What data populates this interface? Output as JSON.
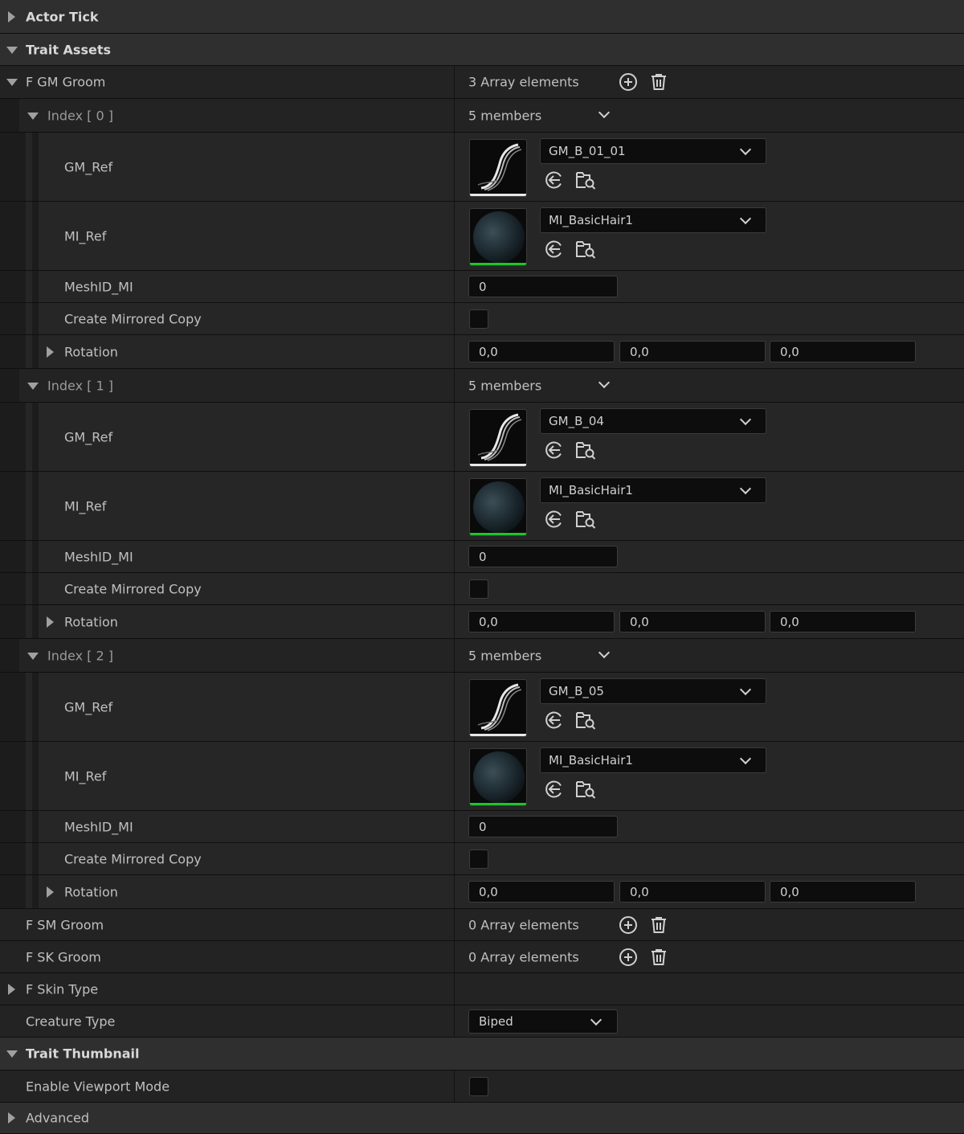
{
  "categories": {
    "actor_tick": "Actor Tick",
    "trait_assets": "Trait Assets",
    "trait_thumbnail": "Trait Thumbnail",
    "advanced": "Advanced"
  },
  "gm_groom": {
    "label": "F GM Groom",
    "count": "3 Array elements",
    "indices": [
      {
        "label": "Index [ 0 ]",
        "members": "5 members",
        "gm_ref_label": "GM_Ref",
        "gm_ref_value": "GM_B_01_01",
        "mi_ref_label": "MI_Ref",
        "mi_ref_value": "MI_BasicHair1",
        "meshid_label": "MeshID_MI",
        "meshid_value": "0",
        "mirror_label": "Create Mirrored Copy",
        "rotation_label": "Rotation",
        "rotation": [
          "0,0",
          "0,0",
          "0,0"
        ]
      },
      {
        "label": "Index [ 1 ]",
        "members": "5 members",
        "gm_ref_label": "GM_Ref",
        "gm_ref_value": "GM_B_04",
        "mi_ref_label": "MI_Ref",
        "mi_ref_value": "MI_BasicHair1",
        "meshid_label": "MeshID_MI",
        "meshid_value": "0",
        "mirror_label": "Create Mirrored Copy",
        "rotation_label": "Rotation",
        "rotation": [
          "0,0",
          "0,0",
          "0,0"
        ]
      },
      {
        "label": "Index [ 2 ]",
        "members": "5 members",
        "gm_ref_label": "GM_Ref",
        "gm_ref_value": "GM_B_05",
        "mi_ref_label": "MI_Ref",
        "mi_ref_value": "MI_BasicHair1",
        "meshid_label": "MeshID_MI",
        "meshid_value": "0",
        "mirror_label": "Create Mirrored Copy",
        "rotation_label": "Rotation",
        "rotation": [
          "0,0",
          "0,0",
          "0,0"
        ]
      }
    ]
  },
  "sm_groom": {
    "label": "F SM Groom",
    "count": "0 Array elements"
  },
  "sk_groom": {
    "label": "F SK Groom",
    "count": "0 Array elements"
  },
  "skin_type": {
    "label": "F Skin Type"
  },
  "creature_type": {
    "label": "Creature Type",
    "value": "Biped"
  },
  "enable_viewport": {
    "label": "Enable Viewport Mode"
  },
  "colors": {
    "groom_bar": "#e8e8e8",
    "material_bar": "#1fc42b",
    "panel_bg": "#262626",
    "category_bg": "#2f2f2f"
  },
  "icons": {
    "add": "plus-circle-icon",
    "delete": "trash-icon",
    "use_selected": "arrow-left-circle-icon",
    "browse": "folder-search-icon"
  }
}
